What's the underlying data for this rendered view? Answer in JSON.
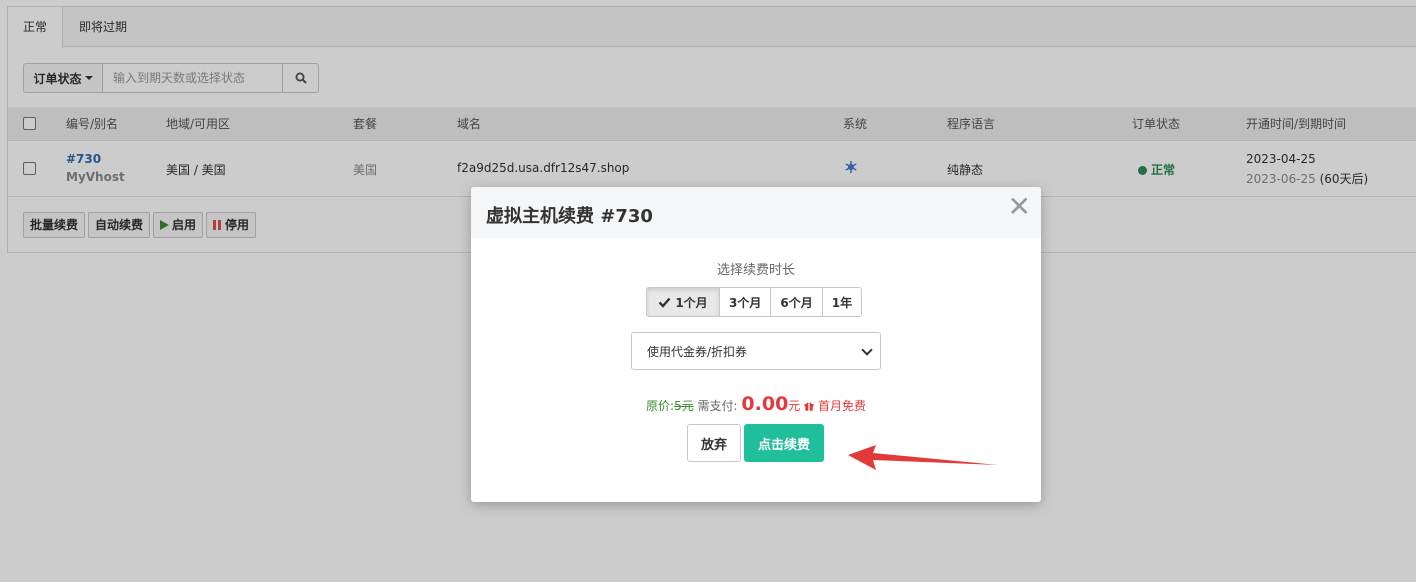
{
  "tabs": [
    {
      "label": "正常"
    },
    {
      "label": "即将过期"
    }
  ],
  "filter": {
    "status_label": "订单状态",
    "search_placeholder": "输入到期天数或选择状态"
  },
  "table": {
    "headers": [
      "编号/别名",
      "地域/可用区",
      "套餐",
      "域名",
      "系统",
      "程序语言",
      "订单状态",
      "开通时间/到期时间"
    ],
    "row": {
      "id": "#730",
      "alias": "MyVhost",
      "region": "美国 / 美国",
      "plan": "美国",
      "domain": "f2a9d25d.usa.dfr12s47.shop",
      "language": "纯静态",
      "status": "正常",
      "open_date": "2023-04-25",
      "expire_date": "2023-06-25",
      "expire_note": "(60天后)"
    }
  },
  "bulk_actions": {
    "batch_renew": "批量续费",
    "auto_renew": "自动续费",
    "enable": "启用",
    "disable": "停用"
  },
  "modal": {
    "title": "虚拟主机续费 #730",
    "close_symbol": "✕",
    "duration_label": "选择续费时长",
    "durations": [
      "1个月",
      "3个月",
      "6个月",
      "1年"
    ],
    "selected_duration": "1个月",
    "coupon_value": "使用代金券/折扣券",
    "price": {
      "orig_label": "原价:",
      "orig_value": "5元",
      "pay_label": "需支付:",
      "amount": "0.00",
      "unit": "元",
      "promo": "首月免费"
    },
    "cancel_label": "放弃",
    "confirm_label": "点击续费"
  },
  "colors": {
    "accent": "#1fbf9c",
    "price": "#e4393c",
    "status_ok": "#2e8b57",
    "link": "#2a6fb0",
    "arrow": "#e23a3a"
  },
  "icons": {
    "search": "search-icon",
    "os": "snowflake-icon",
    "check": "check-icon",
    "gift": "gift-icon",
    "play": "play-icon",
    "pause": "pause-icon"
  }
}
